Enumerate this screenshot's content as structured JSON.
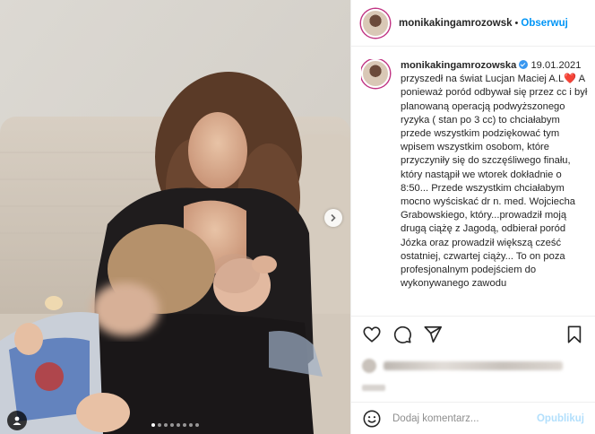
{
  "post": {
    "username": "monikakingamrozowsk",
    "separator": "•",
    "follow_label": "Obserwuj"
  },
  "caption": {
    "username": "monikakingamrozowska",
    "text": "19.01.2021 przyszedł na świat Lucjan Maciej A.L❤️ A ponieważ poród odbywał się przez cc i był planowaną operacją podwyższonego ryzyka ( stan po 3 cc) to chciałabym przede wszystkim podziękować tym wpisem wszystkim osobom, które przyczyniły się do szczęśliwego finału, który nastąpił we wtorek dokładnie o 8:50... Przede wszystkim chciałabym mocno wyściskać dr n. med. Wojciecha Grabowskiego, który...prowadził moją drugą ciążę z Jagodą, odbierał poród Józka oraz prowadził większą cześć ostatniej, czwartej ciąży... To on poza profesjonalnym podejściem do wykonywanego zawodu"
  },
  "carousel": {
    "dot_count": 8,
    "active_index": 0
  },
  "icons": {
    "like": "heart-icon",
    "comment": "comment-icon",
    "share": "share-icon",
    "save": "bookmark-icon",
    "emoji": "emoji-icon",
    "next": "chevron-right-icon",
    "tag": "user-tag-icon"
  },
  "comment": {
    "placeholder": "Dodaj komentarz...",
    "publish_label": "Opublikuj"
  },
  "colors": {
    "accent": "#0095f6",
    "publish_disabled": "#b2dffc",
    "verified": "#3897f0"
  }
}
